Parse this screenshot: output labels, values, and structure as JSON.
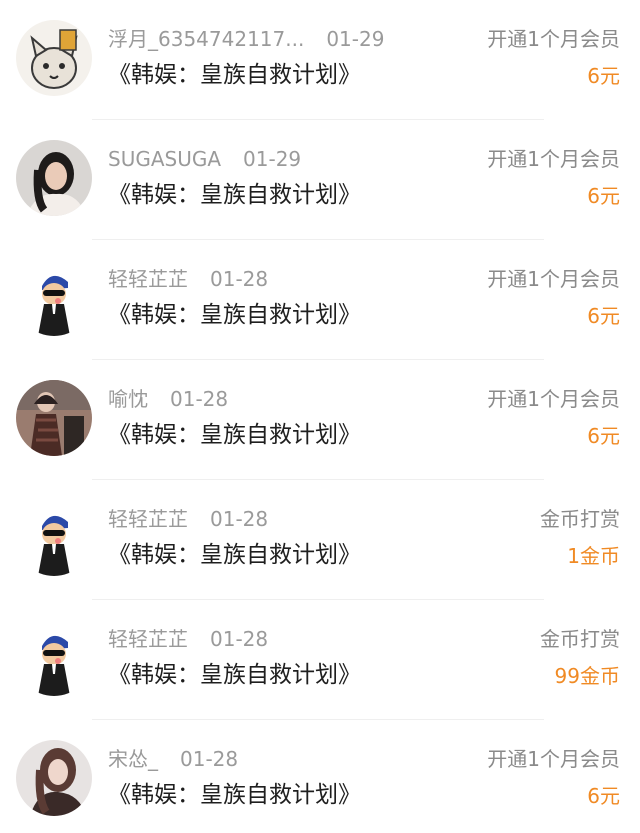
{
  "items": [
    {
      "user": "浮月_6354742117...",
      "date": "01-29",
      "book": "《韩娱：皇族自救计划》",
      "type": "开通1个月会员",
      "amount": "6元",
      "avatar": "cat-cartoon-icon"
    },
    {
      "user": "SUGASUGA",
      "date": "01-29",
      "book": "《韩娱：皇族自救计划》",
      "type": "开通1个月会员",
      "amount": "6元",
      "avatar": "girl-photo-icon"
    },
    {
      "user": "轻轻芷芷",
      "date": "01-28",
      "book": "《韩娱：皇族自救计划》",
      "type": "开通1个月会员",
      "amount": "6元",
      "avatar": "sunglasses-man-icon"
    },
    {
      "user": "喻忱",
      "date": "01-28",
      "book": "《韩娱：皇族自救计划》",
      "type": "开通1个月会员",
      "amount": "6元",
      "avatar": "man-coat-photo-icon"
    },
    {
      "user": "轻轻芷芷",
      "date": "01-28",
      "book": "《韩娱：皇族自救计划》",
      "type": "金币打赏",
      "amount": "1金币",
      "avatar": "sunglasses-man-icon"
    },
    {
      "user": "轻轻芷芷",
      "date": "01-28",
      "book": "《韩娱：皇族自救计划》",
      "type": "金币打赏",
      "amount": "99金币",
      "avatar": "sunglasses-man-icon"
    },
    {
      "user": "宋怂_",
      "date": "01-28",
      "book": "《韩娱：皇族自救计划》",
      "type": "开通1个月会员",
      "amount": "6元",
      "avatar": "woman-portrait-icon"
    }
  ],
  "colors": {
    "amount": "#f08a24",
    "meta": "#9a9a9a",
    "title": "#1f1f1f"
  }
}
